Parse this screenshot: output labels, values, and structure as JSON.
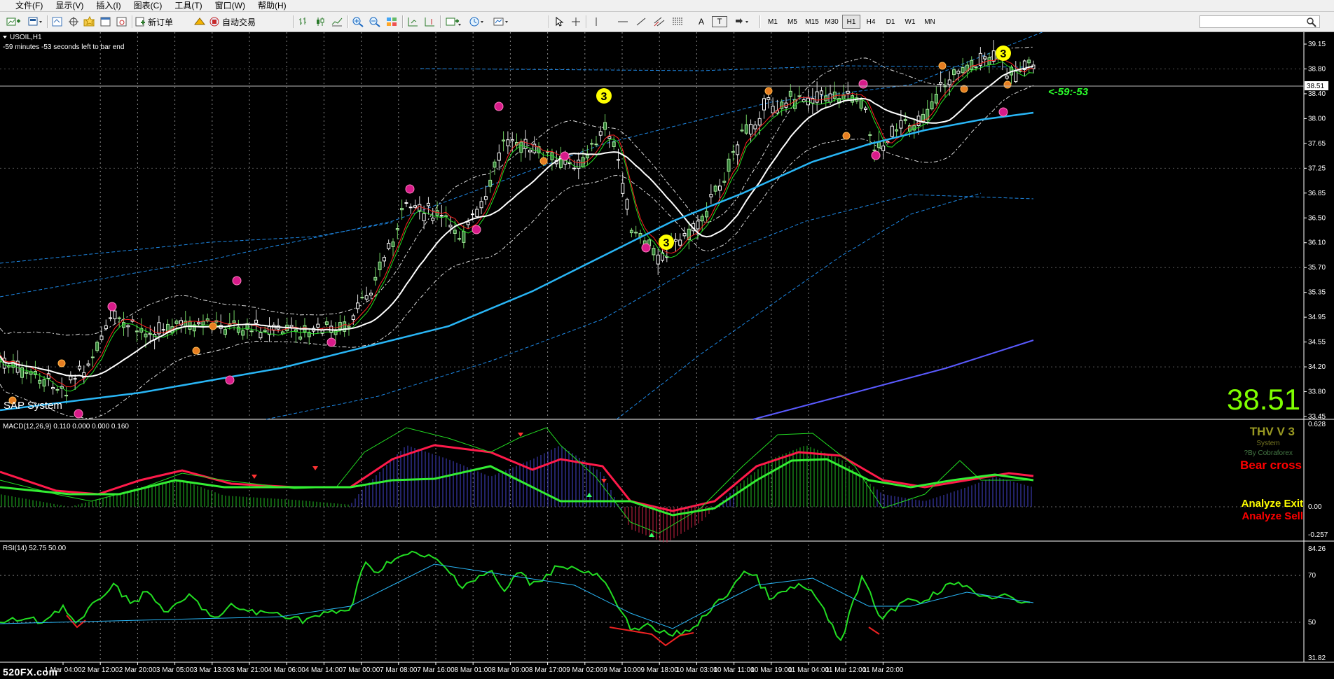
{
  "menu": [
    "文件(F)",
    "显示(V)",
    "插入(I)",
    "图表(C)",
    "工具(T)",
    "窗口(W)",
    "帮助(H)"
  ],
  "toolbar": {
    "new_order": "新订单",
    "auto_trade": "自动交易",
    "timeframes": [
      "M1",
      "M5",
      "M15",
      "M30",
      "H1",
      "H4",
      "D1",
      "W1",
      "MN"
    ],
    "active_timeframe": "H1",
    "text_tool": "A",
    "label_tool": "T"
  },
  "chart": {
    "symbol": "USOIL,H1",
    "timer": "-59 minutes -53 seconds left to bar end",
    "system_label": "SAP System",
    "bar_countdown": "<-59:-53",
    "big_price": "38.51",
    "current_price": "38.51",
    "price_ticks": [
      "39.15",
      "38.80",
      "38.40",
      "38.00",
      "37.65",
      "37.25",
      "36.85",
      "36.50",
      "36.10",
      "35.70",
      "35.35",
      "34.95",
      "34.55",
      "34.20",
      "33.80",
      "33.45"
    ],
    "wave_marks": [
      "3",
      "3",
      "3"
    ],
    "time_labels": [
      "1 Mar 04:00",
      "2 Mar 12:00",
      "2 Mar 20:00",
      "3 Mar 05:00",
      "3 Mar 13:00",
      "3 Mar 21:00",
      "4 Mar 06:00",
      "4 Mar 14:00",
      "7 Mar 00:00",
      "7 Mar 08:00",
      "7 Mar 16:00",
      "8 Mar 01:00",
      "8 Mar 09:00",
      "8 Mar 17:00",
      "9 Mar 02:00",
      "9 Mar 10:00",
      "9 Mar 18:00",
      "10 Mar 03:00",
      "10 Mar 11:00",
      "10 Mar 19:00",
      "11 Mar 04:00",
      "11 Mar 12:00",
      "11 Mar 20:00"
    ]
  },
  "macd": {
    "label": "MACD(12,26,9) 0.110 0.000 0.000 0.160",
    "ticks": [
      "0.628",
      "0.00",
      "-0.257"
    ],
    "thv_title": "THV V 3",
    "thv_system": "System",
    "thv_by": "?By Cobraforex",
    "bear_cross": "Bear cross",
    "analyze_exit": "Analyze Exit",
    "analyze_sell": "Analyze Sell"
  },
  "rsi": {
    "label": "RSI(14) 52.75 50.00",
    "ticks": [
      "84.26",
      "70",
      "50",
      "31.82"
    ]
  },
  "watermark": "520FX.com",
  "colors": {
    "background": "#000000",
    "bull_candle": "#a8e6a0",
    "bear_candle": "#ffffff",
    "ma_white": "#ffffff",
    "ma_blue": "#29b6f6",
    "ma_violet": "#5a5aff",
    "fast_green": "#22dd22",
    "signal_red": "#ff1a4a",
    "wave_yellow": "#ffff00",
    "price_lime": "#7fff00"
  }
}
